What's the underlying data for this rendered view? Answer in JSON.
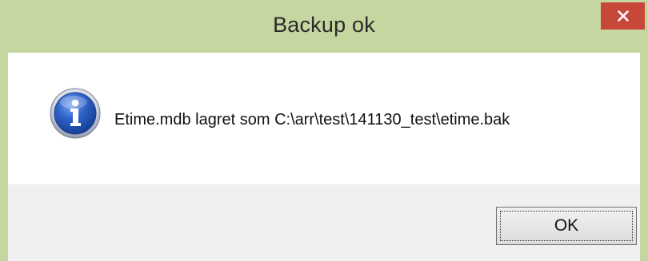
{
  "window": {
    "title": "Backup ok",
    "close_label": "×",
    "colors": {
      "titlebar": "#c5d6a0",
      "close_button": "#c7473a",
      "content": "#ffffff",
      "button_bar": "#f0f0f0"
    }
  },
  "message": {
    "icon": "info-icon",
    "text": "Etime.mdb lagret som C:\\arr\\test\\141130_test\\etime.bak"
  },
  "buttons": {
    "ok_label": "OK"
  }
}
